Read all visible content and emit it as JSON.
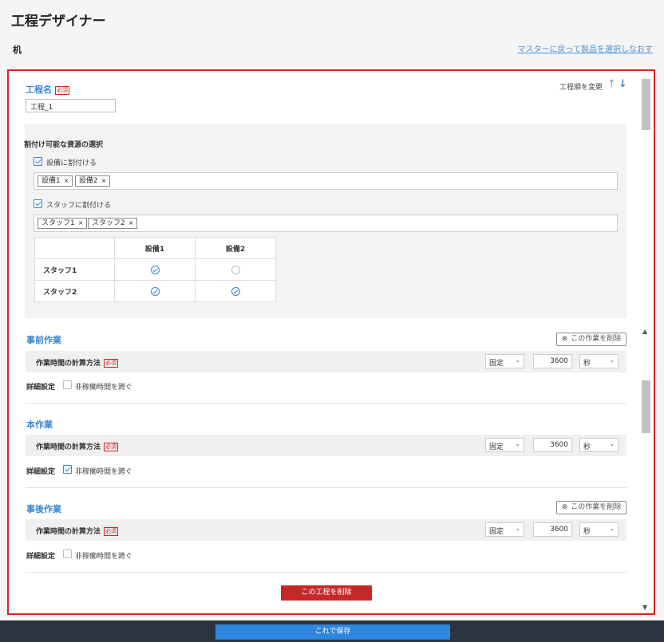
{
  "header": {
    "title": "工程デザイナー",
    "product": "机",
    "back_link": "マスターに戻って製品を選択しなおす"
  },
  "process": {
    "name_label": "工程名",
    "required_badge": "必須",
    "name_value": "工程_1",
    "order_label": "工程順を変更",
    "up_arrow": "↑",
    "down_arrow": "↓"
  },
  "assign": {
    "title": "割付け可能な資源の選択",
    "equipment_checkbox": "設備に割付ける",
    "equipment_chips": [
      "設備1",
      "設備2"
    ],
    "staff_checkbox": "スタッフに割付ける",
    "staff_chips": [
      "スタッフ1",
      "スタッフ2"
    ],
    "chip_remove": "×",
    "matrix": {
      "columns": [
        "設備1",
        "設備2"
      ],
      "rows": [
        {
          "label": "スタッフ1",
          "values": [
            true,
            false
          ]
        },
        {
          "label": "スタッフ2",
          "values": [
            true,
            true
          ]
        }
      ]
    }
  },
  "works": {
    "delete_work_label": "この作業を削除",
    "delete_work_icon": "⊗",
    "calc_label": "作業時間の計算方法",
    "required_badge": "必須",
    "detail_label": "詳細設定",
    "skip_label": "非稼働時間を跨ぐ",
    "items": [
      {
        "title": "事前作業",
        "method": "固定",
        "time": "3600",
        "unit": "秒",
        "skip_checked": false
      },
      {
        "title": "本作業",
        "method": "固定",
        "time": "3600",
        "unit": "秒",
        "skip_checked": true
      },
      {
        "title": "事後作業",
        "method": "固定",
        "time": "3600",
        "unit": "秒",
        "skip_checked": false
      }
    ]
  },
  "actions": {
    "delete_process": "この工程を削除",
    "save": "これで保存"
  },
  "colors": {
    "accent": "#3a86d1",
    "danger": "#c62828",
    "highlight_border": "#e02020",
    "footer_bg": "#2b3542",
    "save_button": "#2e86de"
  }
}
